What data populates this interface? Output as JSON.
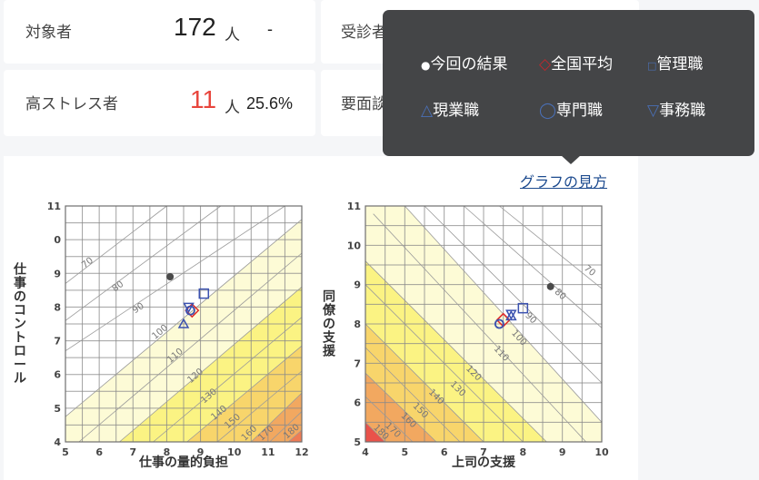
{
  "summary_cards": [
    {
      "label": "対象者",
      "value": "172",
      "unit": "人",
      "extra": "-"
    },
    {
      "label": "高ストレス者",
      "value": "11",
      "unit": "人",
      "extra": "25.6%",
      "value_color": "#e8453c"
    },
    {
      "label": "受診者"
    },
    {
      "label": "要面談"
    }
  ],
  "guide_link": "グラフの見方",
  "legend": {
    "items": [
      {
        "symbol": "●",
        "label": "今回の結果",
        "color": "#ffffff"
      },
      {
        "symbol": "◇",
        "label": "全国平均",
        "color": "#c0282d"
      },
      {
        "symbol": "□",
        "label": "管理職",
        "color": "#4a6fb5"
      },
      {
        "symbol": "△",
        "label": "現業職",
        "color": "#4a6fb5"
      },
      {
        "symbol": "◯",
        "label": "専門職",
        "color": "#4a6fb5"
      },
      {
        "symbol": "▽",
        "label": "事務職",
        "color": "#4a6fb5"
      }
    ]
  },
  "chart_data": [
    {
      "type": "scatter",
      "title": "",
      "xlabel": "仕事の量的負担",
      "ylabel": "仕事のコントロール",
      "xlim": [
        5,
        12
      ],
      "ylim": [
        4,
        11
      ],
      "xticks": [
        "5",
        "6",
        "7",
        "8",
        "9",
        "10",
        "11",
        "12"
      ],
      "yticks": [
        "4",
        "5",
        "6",
        "7",
        "8",
        "9",
        "0",
        "11"
      ],
      "grid": true,
      "contour_labels": [
        "70",
        "80",
        "90",
        "100",
        "110",
        "120",
        "130",
        "140",
        "150",
        "160",
        "170",
        "180"
      ],
      "bands": [
        {
          "from": "100",
          "color": "#fdfbd6"
        },
        {
          "from": "120",
          "color": "#fbf383"
        },
        {
          "from": "140",
          "color": "#f8d56b"
        },
        {
          "from": "160",
          "color": "#f2a860"
        },
        {
          "from": "180",
          "color": "#ee7c55"
        }
      ],
      "points": [
        {
          "series": "今回の結果",
          "marker": "dot",
          "x": 8.1,
          "y": 8.9
        },
        {
          "series": "全国平均",
          "marker": "diamond",
          "x": 8.75,
          "y": 7.9
        },
        {
          "series": "管理職",
          "marker": "square",
          "x": 9.1,
          "y": 8.4
        },
        {
          "series": "現業職",
          "marker": "triangle-up",
          "x": 8.5,
          "y": 7.5
        },
        {
          "series": "専門職",
          "marker": "circle",
          "x": 8.7,
          "y": 7.9
        },
        {
          "series": "事務職",
          "marker": "triangle-down",
          "x": 8.65,
          "y": 8.0
        }
      ]
    },
    {
      "type": "scatter",
      "title": "",
      "xlabel": "上司の支援",
      "ylabel": "同僚の支援",
      "xlim": [
        4,
        10
      ],
      "ylim": [
        5,
        11
      ],
      "xticks": [
        "4",
        "5",
        "6",
        "7",
        "8",
        "9",
        "10"
      ],
      "yticks": [
        "5",
        "6",
        "7",
        "8",
        "9",
        "10",
        "11"
      ],
      "grid": true,
      "contour_labels": [
        "70",
        "80",
        "90",
        "100",
        "110",
        "120",
        "130",
        "140",
        "150",
        "160",
        "170",
        "180"
      ],
      "bands": [
        {
          "from": "100",
          "color": "#fdfbd6"
        },
        {
          "from": "120",
          "color": "#fbf383"
        },
        {
          "from": "140",
          "color": "#f8d56b"
        },
        {
          "from": "160",
          "color": "#f2a860"
        },
        {
          "from": "180",
          "color": "#e9524a"
        }
      ],
      "points": [
        {
          "series": "今回の結果",
          "marker": "dot",
          "x": 8.7,
          "y": 8.95
        },
        {
          "series": "全国平均",
          "marker": "diamond",
          "x": 7.5,
          "y": 8.1
        },
        {
          "series": "管理職",
          "marker": "square",
          "x": 8.0,
          "y": 8.4
        },
        {
          "series": "現業職",
          "marker": "triangle-up",
          "x": 7.7,
          "y": 8.2
        },
        {
          "series": "専門職",
          "marker": "circle",
          "x": 7.4,
          "y": 8.0
        },
        {
          "series": "事務職",
          "marker": "triangle-down",
          "x": 7.7,
          "y": 8.25
        }
      ]
    }
  ]
}
